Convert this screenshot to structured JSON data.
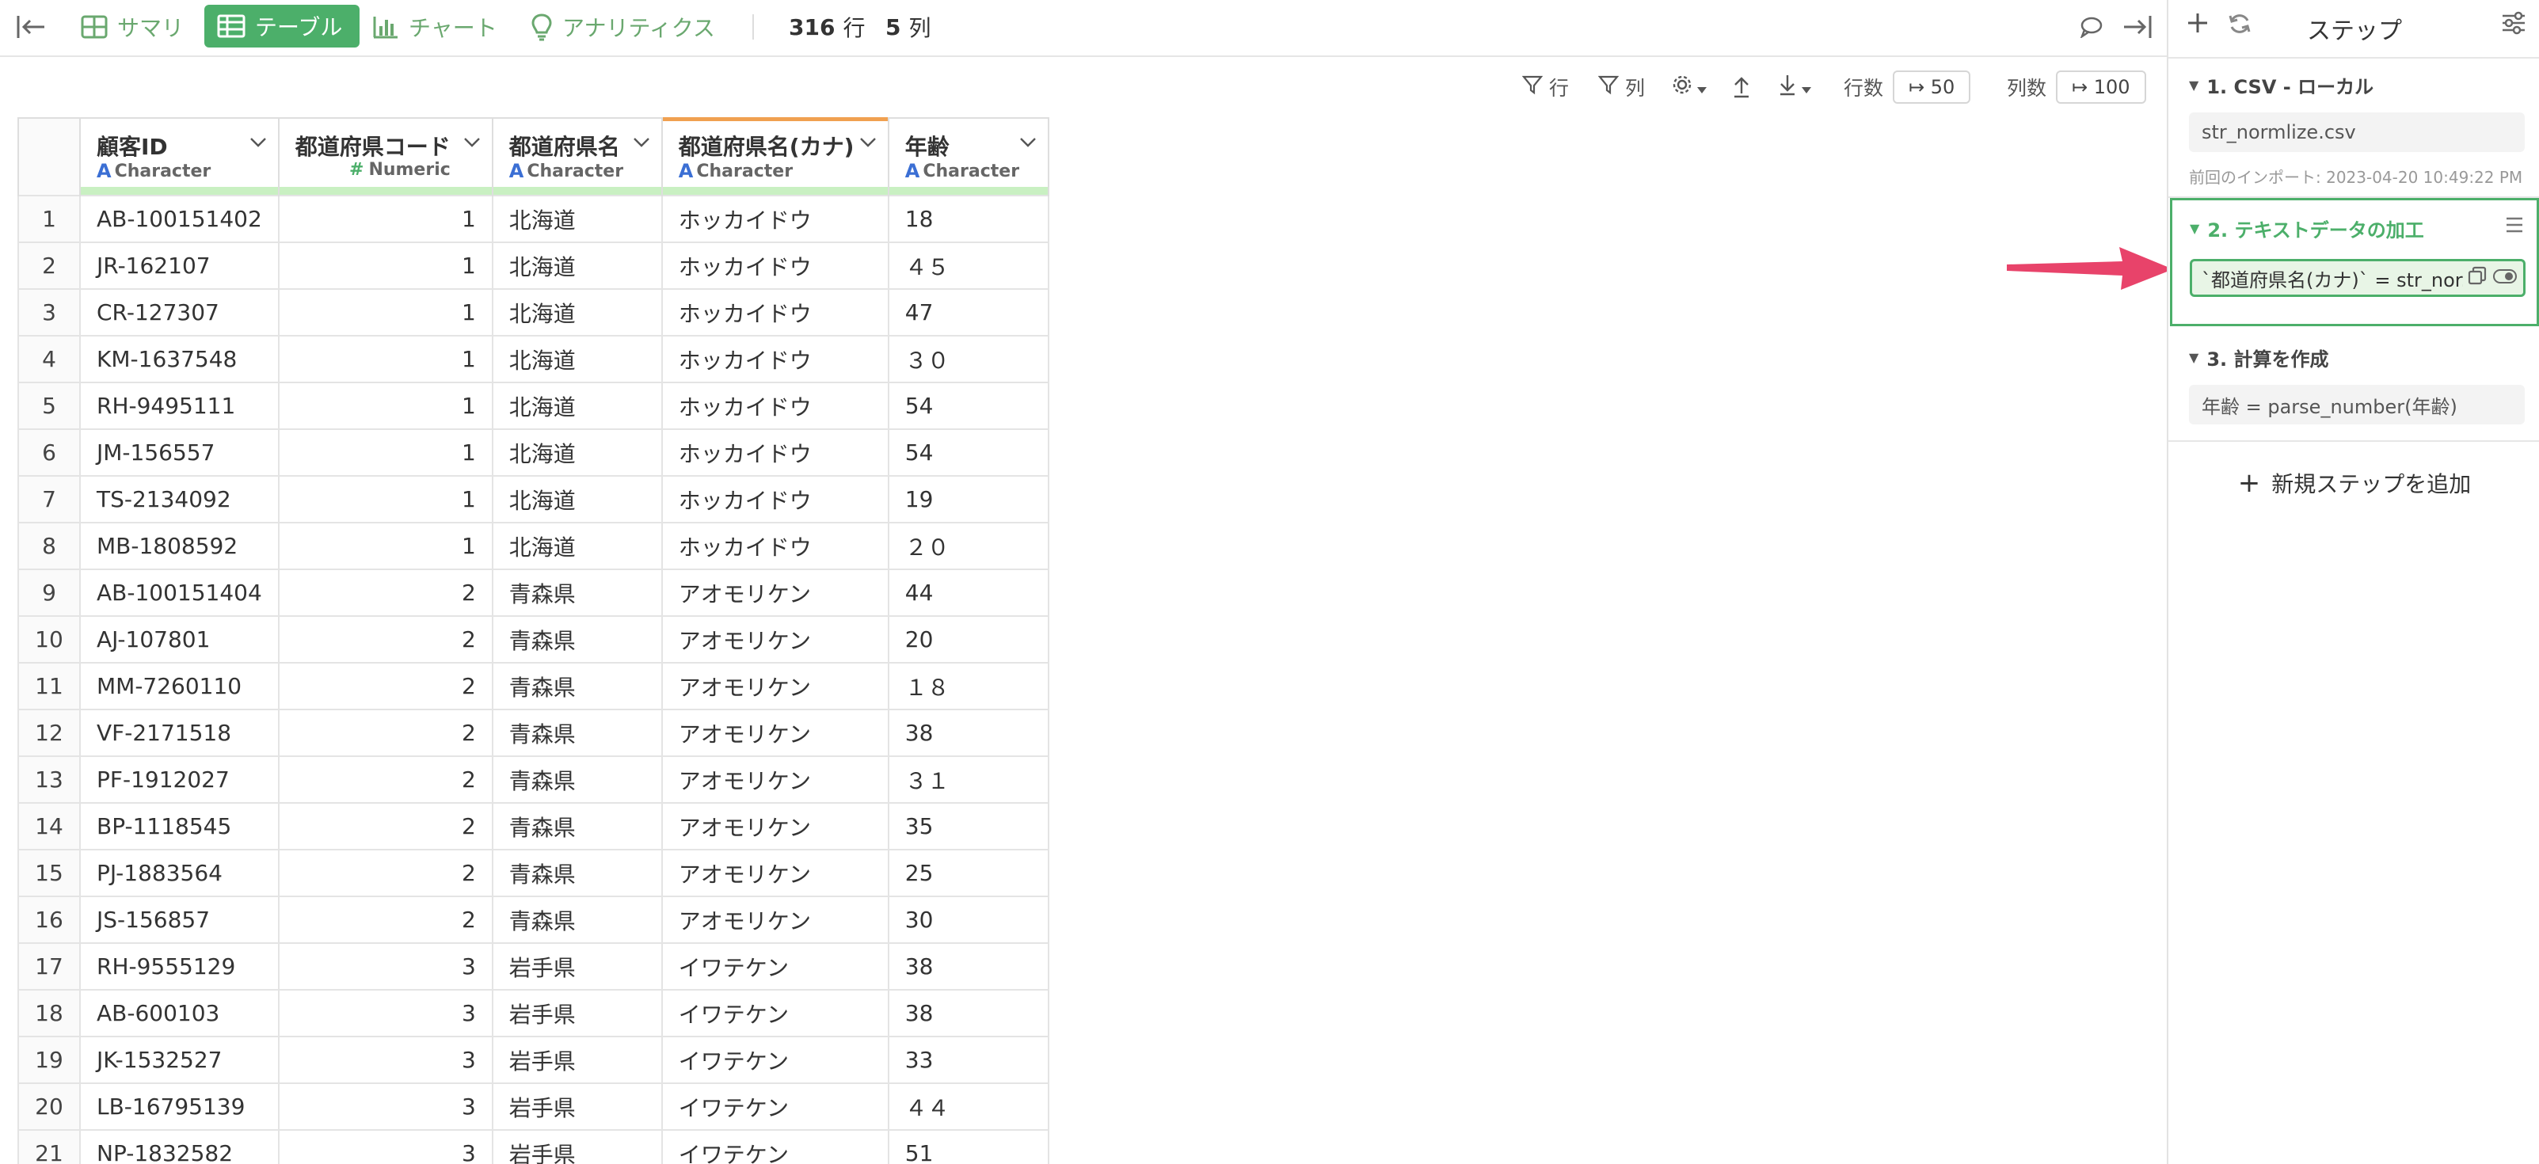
{
  "toolbar": {
    "tabs": [
      {
        "label": "サマリ",
        "icon": "summary-grid-icon"
      },
      {
        "label": "テーブル",
        "icon": "table-icon",
        "active": true
      },
      {
        "label": "チャート",
        "icon": "bar-chart-icon"
      },
      {
        "label": "アナリティクス",
        "icon": "lightbulb-icon"
      }
    ],
    "rows_count": "316",
    "rows_unit": "行",
    "cols_count": "5",
    "cols_unit": "列"
  },
  "subtoolbar": {
    "row_filter": "行",
    "col_filter": "列",
    "rows_label": "行数",
    "rows_value": "↦ 50",
    "cols_label": "列数",
    "cols_value": "↦ 100"
  },
  "table": {
    "columns": [
      {
        "name": "顧客ID",
        "type": "Character"
      },
      {
        "name": "都道府県コード",
        "type": "Numeric"
      },
      {
        "name": "都道府県名",
        "type": "Character"
      },
      {
        "name": "都道府県名(カナ)",
        "type": "Character"
      },
      {
        "name": "年齢",
        "type": "Character"
      }
    ],
    "rows": [
      [
        "1",
        "AB-100151402",
        "1",
        "北海道",
        "ホッカイドウ",
        "18"
      ],
      [
        "2",
        "JR-162107",
        "1",
        "北海道",
        "ホッカイドウ",
        "４５"
      ],
      [
        "3",
        "CR-127307",
        "1",
        "北海道",
        "ホッカイドウ",
        "47"
      ],
      [
        "4",
        "KM-1637548",
        "1",
        "北海道",
        "ホッカイドウ",
        "３０"
      ],
      [
        "5",
        "RH-9495111",
        "1",
        "北海道",
        "ホッカイドウ",
        "54"
      ],
      [
        "6",
        "JM-156557",
        "1",
        "北海道",
        "ホッカイドウ",
        "54"
      ],
      [
        "7",
        "TS-2134092",
        "1",
        "北海道",
        "ホッカイドウ",
        "19"
      ],
      [
        "8",
        "MB-1808592",
        "1",
        "北海道",
        "ホッカイドウ",
        "２０"
      ],
      [
        "9",
        "AB-100151404",
        "2",
        "青森県",
        "アオモリケン",
        "44"
      ],
      [
        "10",
        "AJ-107801",
        "2",
        "青森県",
        "アオモリケン",
        "20"
      ],
      [
        "11",
        "MM-7260110",
        "2",
        "青森県",
        "アオモリケン",
        "１８"
      ],
      [
        "12",
        "VF-2171518",
        "2",
        "青森県",
        "アオモリケン",
        "38"
      ],
      [
        "13",
        "PF-1912027",
        "2",
        "青森県",
        "アオモリケン",
        "３１"
      ],
      [
        "14",
        "BP-1118545",
        "2",
        "青森県",
        "アオモリケン",
        "35"
      ],
      [
        "15",
        "PJ-1883564",
        "2",
        "青森県",
        "アオモリケン",
        "25"
      ],
      [
        "16",
        "JS-156857",
        "2",
        "青森県",
        "アオモリケン",
        "30"
      ],
      [
        "17",
        "RH-9555129",
        "3",
        "岩手県",
        "イワテケン",
        "38"
      ],
      [
        "18",
        "AB-600103",
        "3",
        "岩手県",
        "イワテケン",
        "38"
      ],
      [
        "19",
        "JK-1532527",
        "3",
        "岩手県",
        "イワテケン",
        "33"
      ],
      [
        "20",
        "LB-16795139",
        "3",
        "岩手県",
        "イワテケン",
        "４４"
      ],
      [
        "21",
        "NP-1832582",
        "3",
        "岩手県",
        "イワテケン",
        "51"
      ]
    ]
  },
  "panel": {
    "title": "ステップ",
    "steps": [
      {
        "title": "1. CSV - ローカル",
        "detail": "str_normlize.csv",
        "meta": "前回のインポート: 2023-04-20 10:49:22 PM"
      },
      {
        "title": "2. テキストデータの加工",
        "detail": "`都道府県名(カナ)` = str_nor..."
      },
      {
        "title": "3. 計算を作成",
        "detail": "年齢 = parse_number(年齢)"
      }
    ],
    "add_step_label": "新規ステップを追加"
  },
  "colors": {
    "accent": "#4caf6a",
    "arrow": "#e8436a",
    "type_char": "#3b6fd4"
  }
}
